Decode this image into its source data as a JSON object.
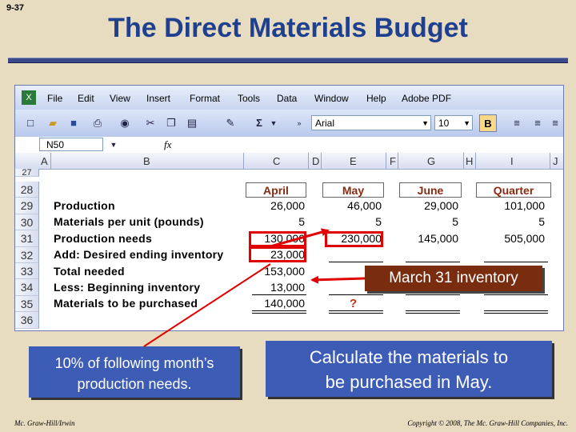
{
  "slide_number": "9-37",
  "title": "The Direct Materials Budget",
  "excel": {
    "menu": [
      "File",
      "Edit",
      "View",
      "Insert",
      "Format",
      "Tools",
      "Data",
      "Window",
      "Help",
      "Adobe PDF"
    ],
    "font_name": "Arial",
    "font_size": "10",
    "bold_label": "B",
    "name_box": "N50",
    "fx_label": "fx",
    "columns": [
      "A",
      "B",
      "C",
      "D",
      "E",
      "F",
      "G",
      "H",
      "I",
      "J"
    ],
    "rows": [
      "27",
      "28",
      "29",
      "30",
      "31",
      "32",
      "33",
      "34",
      "35",
      "36"
    ],
    "headers": {
      "april": "April",
      "may": "May",
      "june": "June",
      "quarter": "Quarter"
    },
    "labels": [
      "Production",
      "Materials per unit (pounds)",
      "Production needs",
      "Add: Desired ending inventory",
      "Total needed",
      "Less: Beginning inventory",
      "Materials to be purchased"
    ],
    "april": [
      "26,000",
      "5",
      "130,000",
      "23,000",
      "153,000",
      "13,000",
      "140,000"
    ],
    "may": [
      "46,000",
      "5",
      "230,000"
    ],
    "june": [
      "29,000",
      "5",
      "145,000"
    ],
    "quarter": [
      "101,000",
      "5",
      "505,000"
    ],
    "question_mark": "?"
  },
  "callouts": {
    "march_inventory": "March 31 inventory",
    "ten_percent_line1": "10% of following month’s",
    "ten_percent_line2": "production needs.",
    "calculate_line1": "Calculate the materials to",
    "calculate_line2": "be purchased in May."
  },
  "footer": {
    "left": "Mc. Graw-Hill/Irwin",
    "right": "Copyright © 2008, The Mc. Graw-Hill Companies, Inc."
  }
}
